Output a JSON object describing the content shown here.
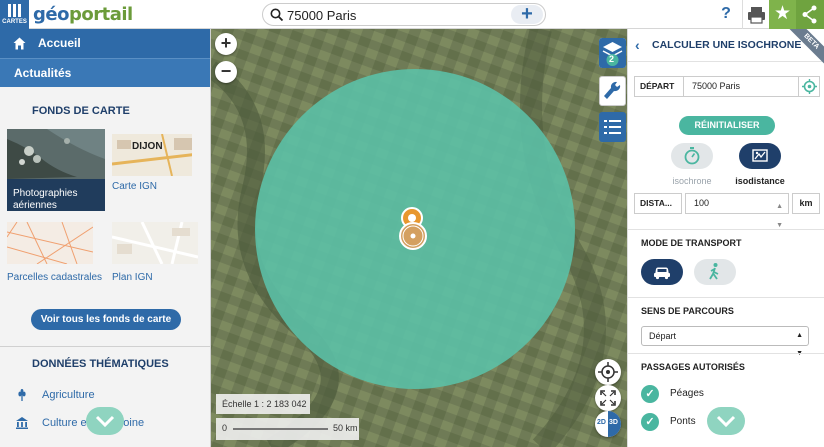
{
  "topbar": {
    "cartes_label": "CARTES",
    "logo_geo": "géo",
    "logo_portail": "portail",
    "search_value": "75000 Paris",
    "help_label": "?"
  },
  "sidebar": {
    "accueil": "Accueil",
    "actualites": "Actualités",
    "fonds_title": "FONDS DE CARTE",
    "tiles": [
      {
        "label": "Photographies aériennes",
        "active": true
      },
      {
        "label": "Carte IGN",
        "active": false,
        "map_text": "DIJON"
      },
      {
        "label": "Parcelles cadastrales",
        "active": false
      },
      {
        "label": "Plan IGN",
        "active": false
      }
    ],
    "see_all": "Voir tous les fonds de carte",
    "themes_title": "DONNÉES THÉMATIQUES",
    "themes": [
      {
        "label": "Agriculture",
        "icon": "wheat-icon"
      },
      {
        "label": "Culture et patrimoine",
        "icon": "museum-icon"
      }
    ]
  },
  "map": {
    "layers_count": "2",
    "scale_text": "Échelle 1 : 2 183 042",
    "scale_zero": "0",
    "scale_km": "50 km",
    "toggle_2d": "2D",
    "toggle_3d": "3D",
    "isochrone_color": "#5bc2a8"
  },
  "panel": {
    "title": "CALCULER UNE ISOCHRONE",
    "beta": "BETA",
    "depart_label": "DÉPART",
    "depart_value": "75000 Paris",
    "reset_label": "RÉINITIALISER",
    "mode_isochrone": "isochrone",
    "mode_isodistance": "isodistance",
    "distance_label": "DISTA...",
    "distance_value": "100",
    "distance_unit": "km",
    "transport_title": "MODE DE TRANSPORT",
    "sens_title": "SENS DE PARCOURS",
    "sens_value": "Départ",
    "passages_title": "PASSAGES AUTORISÉS",
    "passages": [
      "Péages",
      "Ponts"
    ]
  },
  "colors": {
    "brand_blue": "#2e6aa8",
    "accent_green": "#7fb34b",
    "teal": "#4ab6a0",
    "navy": "#1f3f6a"
  }
}
